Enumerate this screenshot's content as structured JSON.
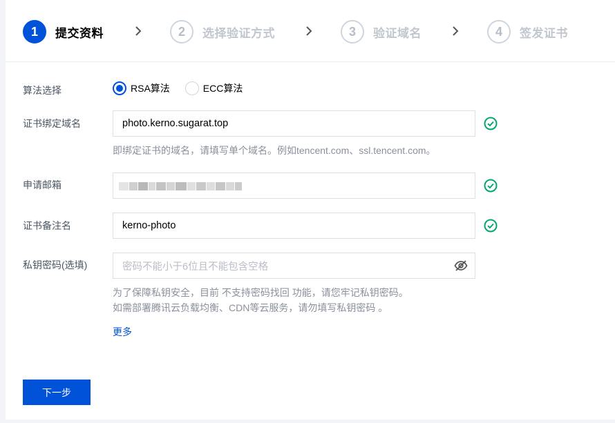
{
  "steps": [
    {
      "num": "1",
      "label": "提交资料"
    },
    {
      "num": "2",
      "label": "选择验证方式"
    },
    {
      "num": "3",
      "label": "验证域名"
    },
    {
      "num": "4",
      "label": "签发证书"
    }
  ],
  "algorithm": {
    "label": "算法选择",
    "options": [
      "RSA算法",
      "ECC算法"
    ],
    "selected": "RSA算法"
  },
  "domain": {
    "label": "证书绑定域名",
    "value": "photo.kerno.sugarat.top",
    "hint": "即绑定证书的域名，请填写单个域名。例如tencent.com、ssl.tencent.com。"
  },
  "email": {
    "label": "申请邮箱"
  },
  "remark": {
    "label": "证书备注名",
    "value": "kerno-photo"
  },
  "password": {
    "label": "私钥密码(选填)",
    "placeholder": "密码不能小于6位且不能包含空格",
    "hint_line1": "为了保障私钥安全，目前 不支持密码找回 功能，请您牢记私钥密码。",
    "hint_line2": "如需部署腾讯云负载均衡、CDN等云服务，请勿填写私钥密码 。",
    "more_link": "更多"
  },
  "next_button": "下一步",
  "colors": {
    "primary": "#0052d9",
    "success": "#00a870"
  }
}
